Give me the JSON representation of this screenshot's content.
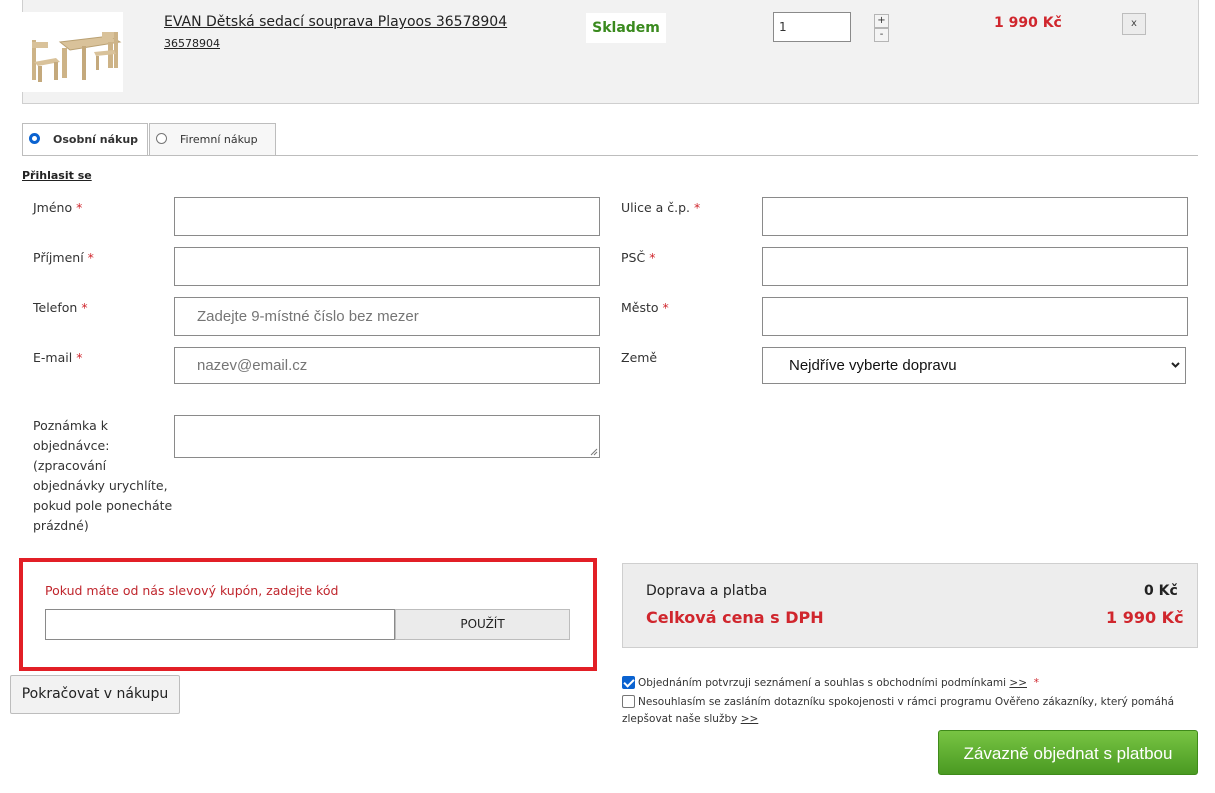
{
  "cart_item": {
    "name": "EVAN Dětská sedací souprava Playoos 36578904",
    "code": "36578904",
    "stock": "Skladem",
    "quantity": "1",
    "qty_plus": "+",
    "qty_minus": "-",
    "price": "1 990 Kč",
    "remove": "x",
    "image_icon": "table-chairs-product-image"
  },
  "tabs": [
    {
      "label": "Osobní nákup",
      "selected": true
    },
    {
      "label": "Firemní nákup",
      "selected": false
    }
  ],
  "login_link": "Přihlasit se",
  "required_mark": "*",
  "form_left": {
    "jmeno": {
      "label": "Jméno",
      "placeholder": ""
    },
    "prijmeni": {
      "label": "Příjmení",
      "placeholder": ""
    },
    "telefon": {
      "label": "Telefon",
      "placeholder": "Zadejte 9-místné číslo bez mezer"
    },
    "email": {
      "label": "E-mail",
      "placeholder": "nazev@email.cz"
    },
    "note_lines": [
      "Poznámka k",
      "objednávce:",
      "(zpracování",
      "objednávky urychlíte,",
      "pokud pole ponecháte",
      "prázdné)"
    ]
  },
  "form_right": {
    "ulice": {
      "label": "Ulice a č.p."
    },
    "psc": {
      "label": "PSČ"
    },
    "mesto": {
      "label": "Město"
    },
    "zeme": {
      "label": "Země",
      "selected": "Nejdříve vyberte dopravu"
    }
  },
  "coupon": {
    "text": "Pokud máte od nás slevový kupón, zadejte kód",
    "button": "POUŽÍT"
  },
  "summary": {
    "shipping_label": "Doprava a platba",
    "shipping_value": "0 Kč",
    "total_label": "Celková cena s DPH",
    "total_value": "1 990 Kč"
  },
  "consents": [
    {
      "text": "Objednáním potvrzuji seznámení a souhlas s obchodními podmínkami",
      "link": ">>",
      "checked": true,
      "required": "*"
    },
    {
      "text": "Nesouhlasím se zasláním dotazníku spokojenosti v rámci programu Ověřeno zákazníky, který pomáhá",
      "text2": "zlepšovat naše služby",
      "link": ">>",
      "checked": false
    }
  ],
  "buttons": {
    "continue": "Pokračovat v nákupu",
    "order": "Závazně objednat s platbou"
  },
  "colors": {
    "accent_red": "#d0262d",
    "stock_green": "#3a8a1e",
    "order_green": "#5aab2d",
    "highlight_border": "#e21f26"
  }
}
